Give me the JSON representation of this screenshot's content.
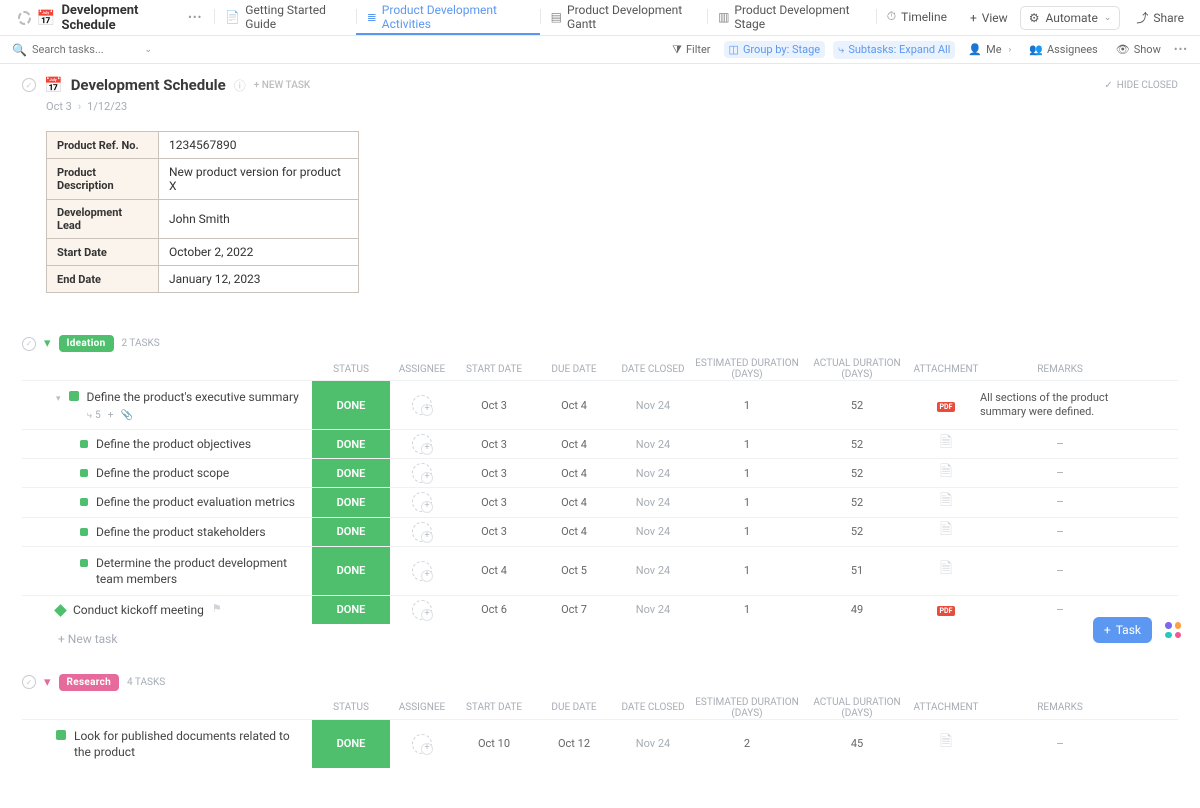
{
  "header": {
    "doc_title": "Development Schedule",
    "tabs": [
      {
        "label": "Getting Started Guide"
      },
      {
        "label": "Product Development Activities"
      },
      {
        "label": "Product Development Gantt"
      },
      {
        "label": "Product Development Stage"
      },
      {
        "label": "Timeline"
      }
    ],
    "add_view": "View",
    "automate": "Automate",
    "share": "Share"
  },
  "toolbar": {
    "search_placeholder": "Search tasks...",
    "filter": "Filter",
    "group_by": "Group by: Stage",
    "subtasks": "Subtasks: Expand All",
    "me": "Me",
    "assignees": "Assignees",
    "show": "Show"
  },
  "page": {
    "title": "Development Schedule",
    "new_task": "+ NEW TASK",
    "hide_closed": "HIDE CLOSED",
    "date_start": "Oct 3",
    "date_end": "1/12/23"
  },
  "info": {
    "rows": [
      {
        "label": "Product Ref. No.",
        "value": "1234567890"
      },
      {
        "label": "Product Description",
        "value": "New product version for product X"
      },
      {
        "label": "Development Lead",
        "value": "John Smith"
      },
      {
        "label": "Start Date",
        "value": "October 2, 2022"
      },
      {
        "label": "End Date",
        "value": "January 12, 2023"
      }
    ]
  },
  "columns": {
    "status": "STATUS",
    "assignee": "ASSIGNEE",
    "start": "START DATE",
    "due": "DUE DATE",
    "closed": "DATE CLOSED",
    "est": "ESTIMATED DURATION (DAYS)",
    "act": "ACTUAL DURATION (DAYS)",
    "att": "ATTACHMENT",
    "rem": "REMARKS"
  },
  "groups": {
    "ideation": {
      "label": "Ideation",
      "count": "2 TASKS",
      "tasks": [
        {
          "name": "Define the product's executive summary",
          "status": "DONE",
          "start": "Oct 3",
          "due": "Oct 4",
          "closed": "Nov 24",
          "est": "1",
          "act": "52",
          "att_type": "pdf",
          "remarks": "All sections of the product summary were defined.",
          "sub_count": "5"
        },
        {
          "name": "Define the product objectives",
          "status": "DONE",
          "start": "Oct 3",
          "due": "Oct 4",
          "closed": "Nov 24",
          "est": "1",
          "act": "52",
          "att_type": "file",
          "remarks": "–"
        },
        {
          "name": "Define the product scope",
          "status": "DONE",
          "start": "Oct 3",
          "due": "Oct 4",
          "closed": "Nov 24",
          "est": "1",
          "act": "52",
          "att_type": "file",
          "remarks": "–"
        },
        {
          "name": "Define the product evaluation metrics",
          "status": "DONE",
          "start": "Oct 3",
          "due": "Oct 4",
          "closed": "Nov 24",
          "est": "1",
          "act": "52",
          "att_type": "file",
          "remarks": "–"
        },
        {
          "name": "Define the product stakeholders",
          "status": "DONE",
          "start": "Oct 3",
          "due": "Oct 4",
          "closed": "Nov 24",
          "est": "1",
          "act": "52",
          "att_type": "file",
          "remarks": "–"
        },
        {
          "name": "Determine the product development team members",
          "status": "DONE",
          "start": "Oct 4",
          "due": "Oct 5",
          "closed": "Nov 24",
          "est": "1",
          "act": "51",
          "att_type": "file",
          "remarks": "–"
        },
        {
          "name": "Conduct kickoff meeting",
          "status": "DONE",
          "start": "Oct 6",
          "due": "Oct 7",
          "closed": "Nov 24",
          "est": "1",
          "act": "49",
          "att_type": "pdf",
          "remarks": "–"
        }
      ],
      "new_task": "+ New task"
    },
    "research": {
      "label": "Research",
      "count": "4 TASKS",
      "tasks": [
        {
          "name": "Look for published documents related to the product",
          "status": "DONE",
          "start": "Oct 10",
          "due": "Oct 12",
          "closed": "Nov 24",
          "est": "2",
          "act": "45",
          "att_type": "file",
          "remarks": "–"
        }
      ]
    }
  },
  "fab": {
    "task": "Task"
  }
}
